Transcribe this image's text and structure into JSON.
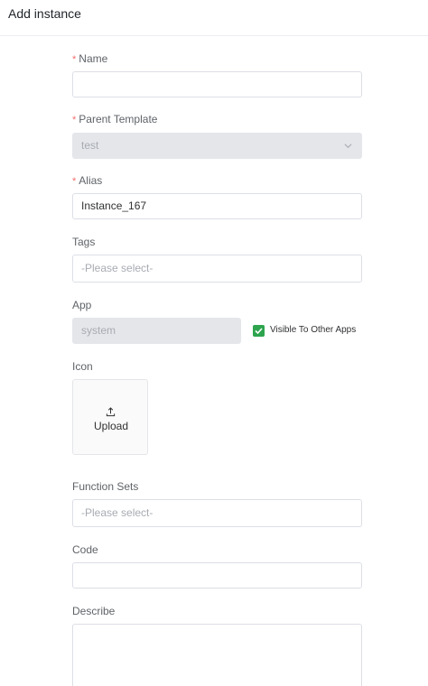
{
  "header": {
    "title": "Add instance"
  },
  "form": {
    "name": {
      "label": "Name",
      "required_mark": "*",
      "value": ""
    },
    "parent_template": {
      "label": "Parent Template",
      "required_mark": "*",
      "value": "test"
    },
    "alias": {
      "label": "Alias",
      "required_mark": "*",
      "value": "Instance_167"
    },
    "tags": {
      "label": "Tags",
      "placeholder": "-Please select-"
    },
    "app": {
      "label": "App",
      "value": "system",
      "visible_checkbox_label": "Visible To Other Apps",
      "visible_checked": true
    },
    "icon": {
      "label": "Icon",
      "upload_label": "Upload"
    },
    "function_sets": {
      "label": "Function Sets",
      "placeholder": "-Please select-"
    },
    "code": {
      "label": "Code",
      "value": ""
    },
    "describe": {
      "label": "Describe",
      "value": ""
    }
  },
  "colors": {
    "required": "#f56c6c",
    "checkbox": "#2ea44f",
    "disabled_bg": "#e4e6ea"
  },
  "icons": {
    "select_arrow": "chevron-down-icon",
    "upload": "upload-icon",
    "checkbox": "checkmark-icon"
  }
}
